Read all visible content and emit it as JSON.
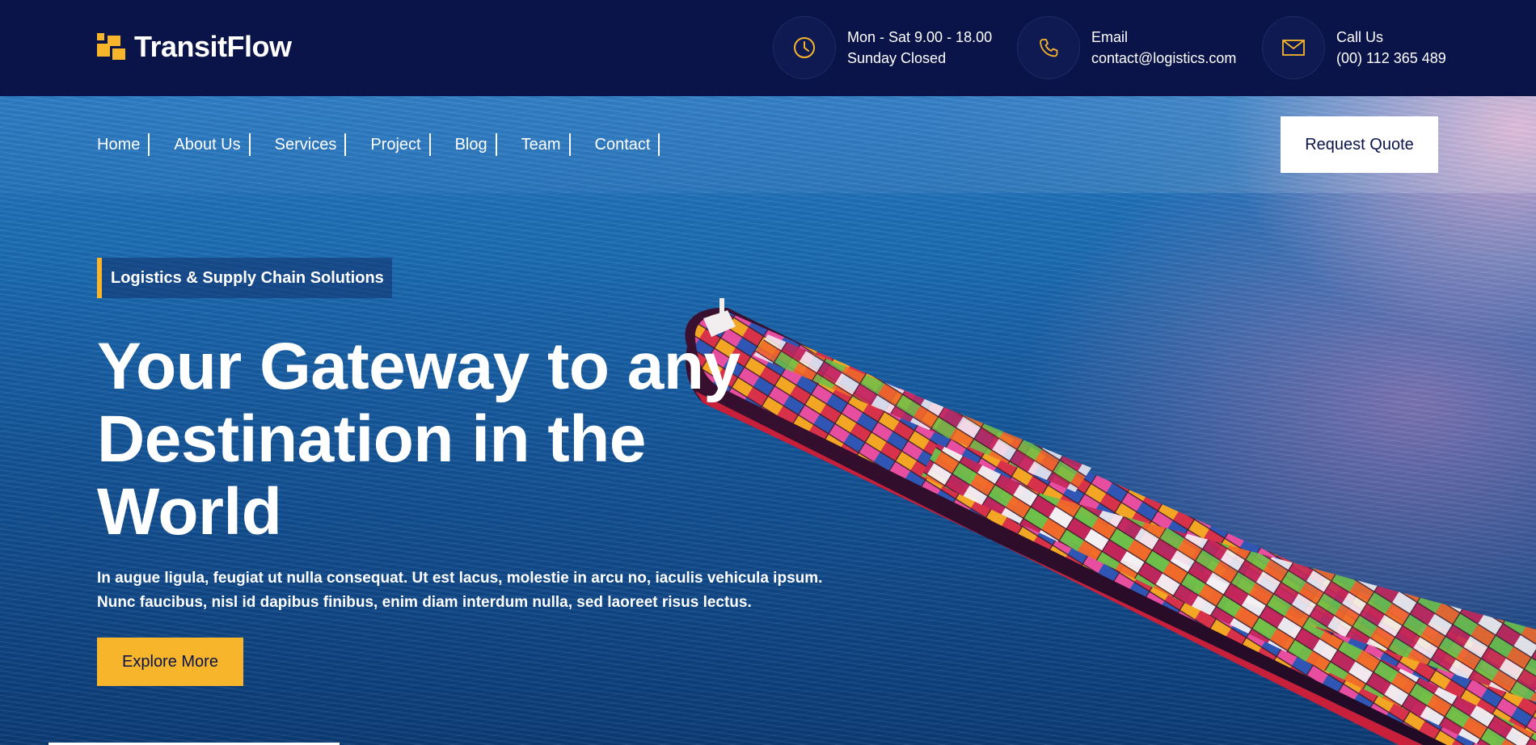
{
  "brand": {
    "name": "TransitFlow",
    "logo_color": "#f7b52c"
  },
  "header": {
    "contacts": [
      {
        "icon": "clock-icon",
        "line1": "Mon - Sat 9.00 - 18.00",
        "line2": "Sunday Closed"
      },
      {
        "icon": "phone-icon",
        "line1": "Email",
        "line2": "contact@logistics.com"
      },
      {
        "icon": "mail-icon",
        "line1": "Call Us",
        "line2": "(00) 112 365 489"
      }
    ],
    "background": "#0b1448"
  },
  "nav": {
    "items": [
      "Home",
      "About Us",
      "Services",
      "Project",
      "Blog",
      "Team",
      "Contact"
    ],
    "cta_label": "Request Quote"
  },
  "hero": {
    "tagline": "Logistics & Supply Chain Solutions",
    "headline_lines": [
      "Your Gateway to any",
      "Destination in the",
      "World"
    ],
    "description_lines": [
      "In augue ligula, feugiat ut nulla consequat. Ut est lacus, molestie in arcu no, iaculis vehicula ipsum.",
      "Nunc faucibus, nisl id dapibus finibus, enim diam interdum nulla, sed laoreet risus lectus."
    ],
    "cta_label": "Explore More",
    "accent_color": "#f7b52c"
  }
}
